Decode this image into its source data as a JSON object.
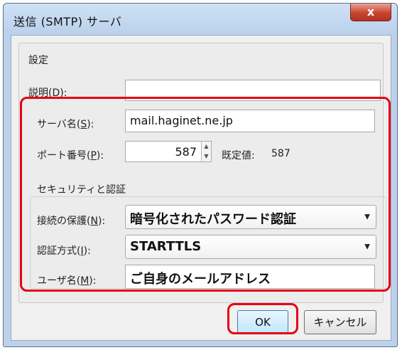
{
  "dialog": {
    "title": "送信 (SMTP) サーバ",
    "close_label": "x"
  },
  "settings": {
    "group_title": "設定",
    "description": {
      "label_pre": "説明(",
      "key": "D",
      "label_post": "):",
      "value": ""
    },
    "server_name": {
      "label_pre": "サーバ名(",
      "key": "S",
      "label_post": "):",
      "value": "mail.haginet.ne.jp"
    },
    "port": {
      "label_pre": "ポート番号(",
      "key": "P",
      "label_post": "):",
      "value": "587",
      "default_label": "既定値:",
      "default_value": "587"
    }
  },
  "security": {
    "group_title": "セキュリティと認証",
    "connection": {
      "label_pre": "接続の保護(",
      "key": "N",
      "label_post": "):",
      "value": "暗号化されたパスワード認証"
    },
    "auth_method": {
      "label_pre": "認証方式(",
      "key": "I",
      "label_post": "):",
      "value": "STARTTLS"
    },
    "username": {
      "label_pre": "ユーザ名(",
      "key": "M",
      "label_post": "):",
      "value": "ご自身のメールアドレス"
    }
  },
  "buttons": {
    "ok": "OK",
    "cancel": "キャンセル"
  },
  "colors": {
    "highlight": "#e60012",
    "titlebar": "#bcd2ec",
    "close": "#c9452f"
  }
}
